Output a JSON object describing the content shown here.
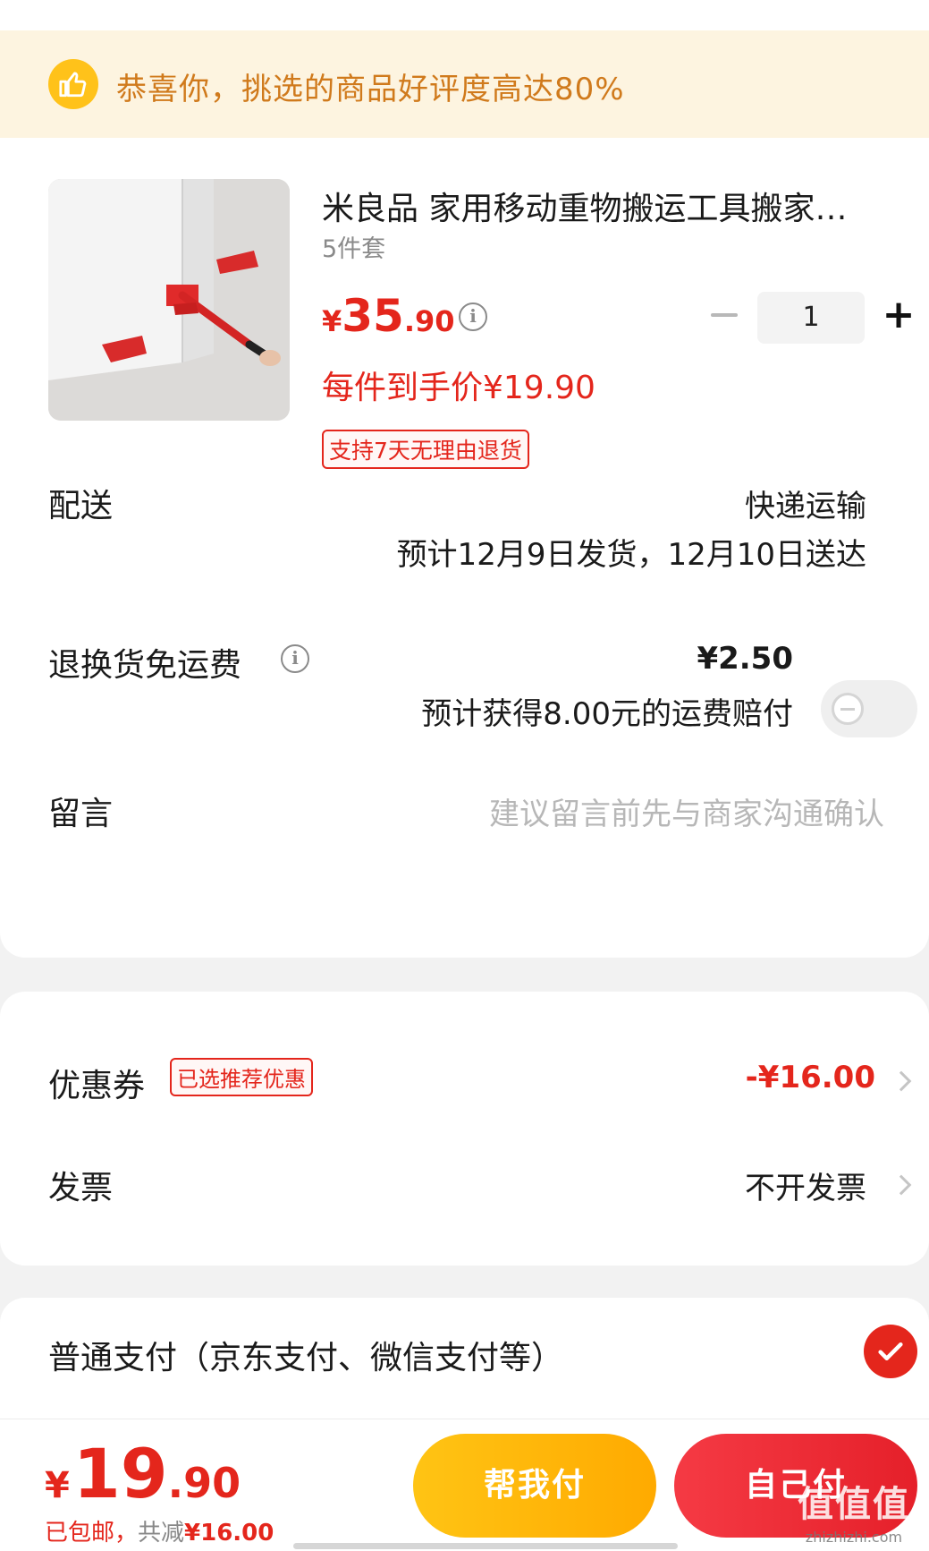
{
  "banner": {
    "text": "恭喜你，挑选的商品好评度高达80%",
    "icon": "thumbs-up-icon"
  },
  "product": {
    "title": "米良品 家用移动重物搬运工具搬家…",
    "spec": "5件套",
    "price_yen": "¥",
    "price_int": "35",
    "price_dec": ".90",
    "each_price": "每件到手价¥19.90",
    "return_tag": "支持7天无理由退货",
    "quantity": "1",
    "minus_symbol": "−",
    "plus_symbol": "+"
  },
  "delivery": {
    "label": "配送",
    "method": "快递运输",
    "estimate": "预计12月9日发货，12月10日送达"
  },
  "return_fee": {
    "label": "退换货免运费",
    "price": "¥2.50",
    "compensation": "预计获得8.00元的运费赔付",
    "toggle_on": false
  },
  "message": {
    "label": "留言",
    "placeholder": "建议留言前先与商家沟通确认"
  },
  "coupon": {
    "label": "优惠券",
    "tag": "已选推荐优惠",
    "value": "-¥16.00"
  },
  "invoice": {
    "label": "发票",
    "value": "不开发票"
  },
  "payment": {
    "label": "普通支付（京东支付、微信支付等）",
    "selected": true
  },
  "bottom": {
    "total_yen": "¥",
    "total_int": "19",
    "total_dec": ".90",
    "free_shipping": "已包邮，",
    "reduced_label": "共减",
    "reduced_value": "¥16.00",
    "help_pay_label": "帮我付",
    "self_pay_label": "自己付"
  },
  "watermark": {
    "main": "值值值",
    "sub": "zhizhizhi.com"
  },
  "colors": {
    "accent_red": "#e4261c",
    "banner_bg": "#fdf4e0",
    "banner_text": "#d07a1c",
    "help_button": "#ffb700",
    "self_button": "#ee2d36"
  }
}
